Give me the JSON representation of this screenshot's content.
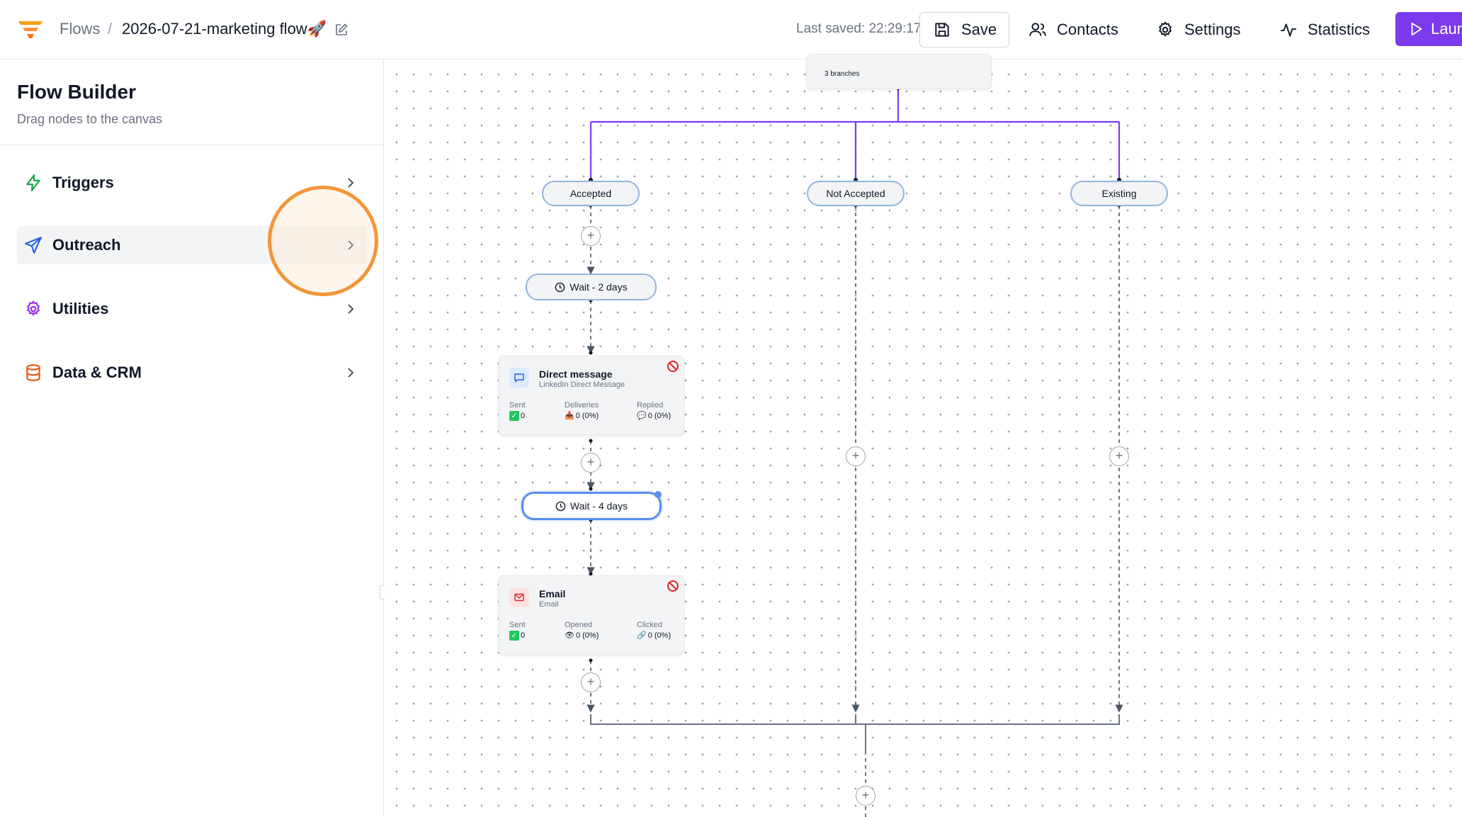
{
  "header": {
    "breadcrumb_root": "Flows",
    "breadcrumb_sep": "/",
    "flow_name": "2026-07-21-marketing flow🚀",
    "last_saved": "Last saved: 22:29:17",
    "save_label": "Save",
    "contacts_label": "Contacts",
    "settings_label": "Settings",
    "statistics_label": "Statistics",
    "launch_label": "Laun",
    "accent_color": "#7c3aed"
  },
  "sidebar": {
    "title": "Flow Builder",
    "subtitle": "Drag nodes to the canvas",
    "items": [
      {
        "label": "Triggers",
        "icon": "lightning-icon",
        "color": "#16a34a"
      },
      {
        "label": "Outreach",
        "icon": "send-icon",
        "color": "#2563eb",
        "active": true
      },
      {
        "label": "Utilities",
        "icon": "gear-icon",
        "color": "#9333ea"
      },
      {
        "label": "Data & CRM",
        "icon": "database-icon",
        "color": "#ea580c"
      }
    ]
  },
  "canvas": {
    "branch_node": {
      "label": "3 branches"
    },
    "branches": [
      {
        "label": "Accepted"
      },
      {
        "label": "Not Accepted"
      },
      {
        "label": "Existing"
      }
    ],
    "wait_1": {
      "label": "Wait - 2 days"
    },
    "wait_2": {
      "label": "Wait - 4 days",
      "selected": true
    },
    "direct_message": {
      "title": "Direct message",
      "subtitle": "LinkedIn Direct Message",
      "stats": [
        {
          "label": "Sent",
          "value": "0"
        },
        {
          "label": "Deliveries",
          "value": "0 (0%)"
        },
        {
          "label": "Replied",
          "value": "0 (0%)"
        }
      ]
    },
    "email": {
      "title": "Email",
      "subtitle": "Email",
      "stats": [
        {
          "label": "Sent",
          "value": "0"
        },
        {
          "label": "Opened",
          "value": "0 (0%)"
        },
        {
          "label": "Clicked",
          "value": "0 (0%)"
        }
      ]
    },
    "plus_symbol": "+",
    "branch_line_color": "#7c3aed"
  }
}
